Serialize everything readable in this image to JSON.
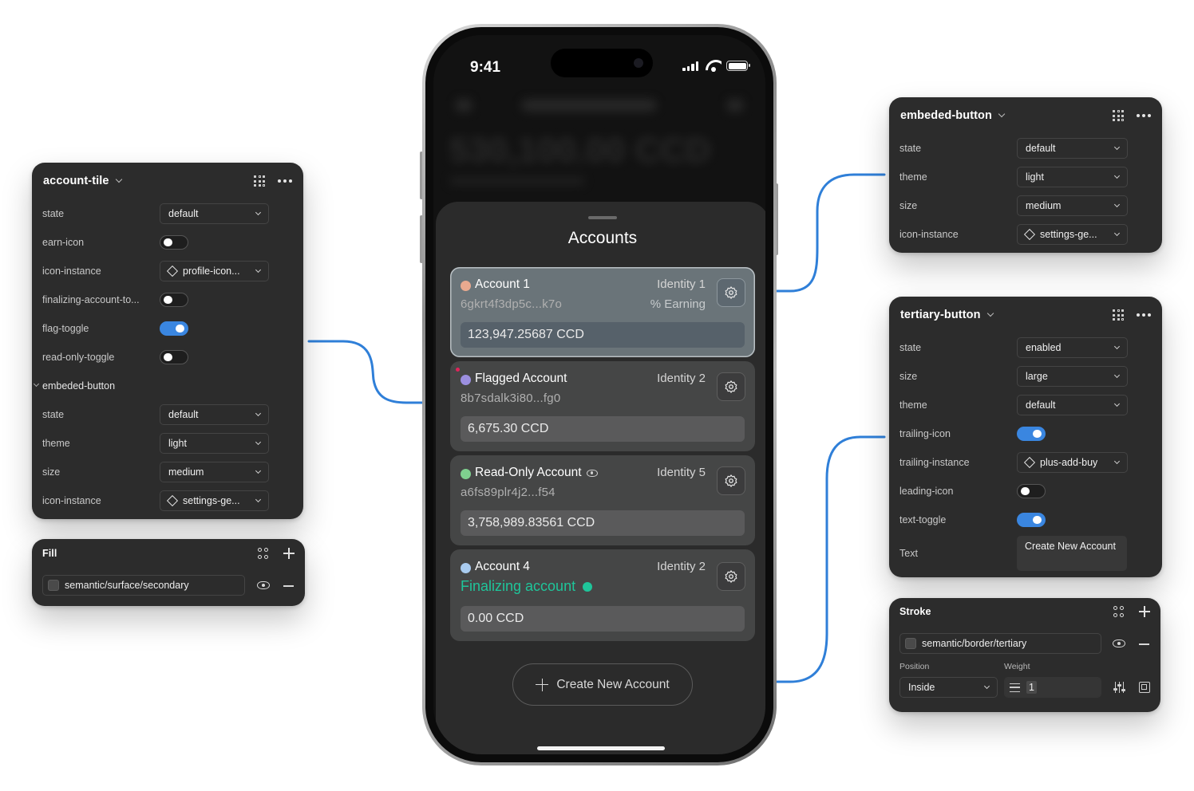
{
  "account_tile_panel": {
    "title": "account-tile",
    "rows": [
      {
        "label": "state",
        "value": "default"
      },
      {
        "label": "earn-icon"
      },
      {
        "label": "icon-instance",
        "value": "profile-icon..."
      },
      {
        "label": "finalizing-account-to..."
      },
      {
        "label": "flag-toggle"
      },
      {
        "label": "read-only-toggle"
      }
    ],
    "toggles": {
      "earn_icon": false,
      "finalizing_account": false,
      "flag_toggle": true,
      "read_only_toggle": false
    },
    "nested": {
      "title": "embeded-button",
      "rows": [
        {
          "label": "state",
          "value": "default"
        },
        {
          "label": "theme",
          "value": "light"
        },
        {
          "label": "size",
          "value": "medium"
        },
        {
          "label": "icon-instance",
          "value": "settings-ge..."
        }
      ]
    }
  },
  "fill_panel": {
    "title": "Fill",
    "value": "semantic/surface/secondary"
  },
  "embeded_button_panel": {
    "title": "embeded-button",
    "rows": [
      {
        "label": "state",
        "value": "default"
      },
      {
        "label": "theme",
        "value": "light"
      },
      {
        "label": "size",
        "value": "medium"
      },
      {
        "label": "icon-instance",
        "value": "settings-ge..."
      }
    ]
  },
  "tertiary_button_panel": {
    "title": "tertiary-button",
    "rows": [
      {
        "label": "state",
        "value": "enabled"
      },
      {
        "label": "size",
        "value": "large"
      },
      {
        "label": "theme",
        "value": "default"
      },
      {
        "label": "trailing-icon"
      },
      {
        "label": "trailing-instance",
        "value": "plus-add-buy"
      },
      {
        "label": "leading-icon"
      },
      {
        "label": "text-toggle"
      },
      {
        "label": "Text",
        "value": "Create New Account"
      }
    ],
    "toggles": {
      "trailing_icon": true,
      "leading_icon": false,
      "text_toggle": true
    }
  },
  "stroke_panel": {
    "title": "Stroke",
    "value": "semantic/border/tertiary",
    "position_label": "Position",
    "position_value": "Inside",
    "weight_label": "Weight",
    "weight_value": "1"
  },
  "phone": {
    "time": "9:41",
    "blurred_balance": "530,100.00 CCD",
    "sheet_title": "Accounts",
    "accounts": [
      {
        "name": "Account 1",
        "address": "6gkrt4f3dp5c...k7o",
        "identity": "Identity 1",
        "status": "% Earning",
        "balance": "123,947.25687 CCD",
        "dot_color": "#e9a98f",
        "selected": true
      },
      {
        "name": "Flagged Account",
        "address": "8b7sdalk3i80...fg0",
        "identity": "Identity 2",
        "balance": "6,675.30 CCD",
        "dot_color": "#9b8fe0",
        "flagged": true
      },
      {
        "name": "Read-Only Account",
        "address": "a6fs89plr4j2...f54",
        "identity": "Identity 5",
        "balance": "3,758,989.83561 CCD",
        "dot_color": "#7fd18f",
        "read_only": true
      },
      {
        "name": "Account 4",
        "status": "Finalizing account",
        "identity": "Identity 2",
        "balance": "0.00 CCD",
        "dot_color": "#a9cbef"
      }
    ],
    "create_button": "Create New Account"
  },
  "colors": {
    "connector": "#2f7fd8",
    "toggle_on": "#3a86e0",
    "finalizing": "#1fc59a",
    "panel_bg": "#2c2c2c"
  }
}
